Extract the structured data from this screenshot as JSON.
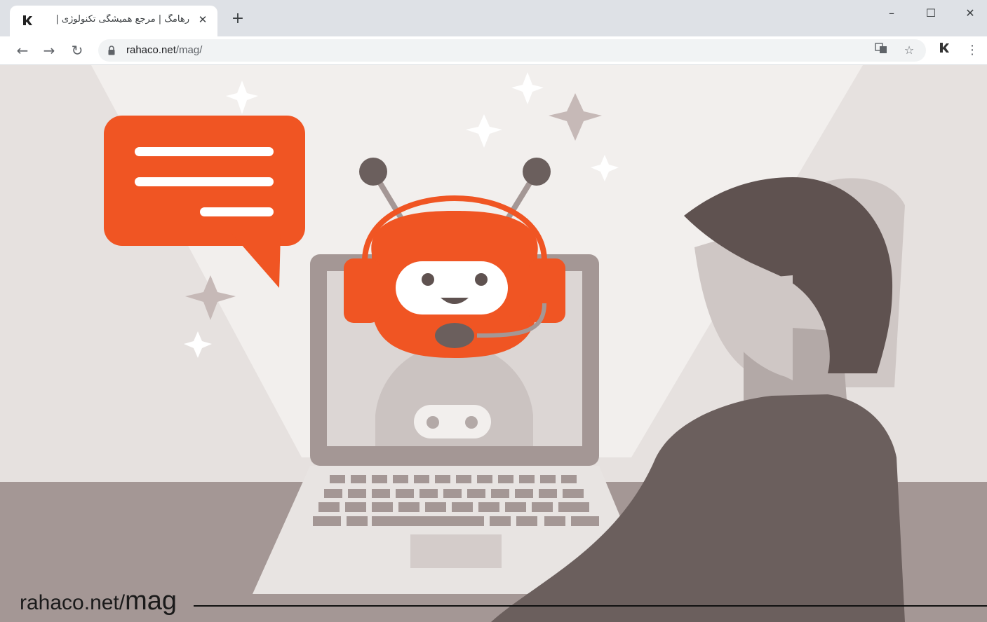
{
  "browser": {
    "tab": {
      "title": "رهامگ | مرجع همیشگی تکنولوژی |",
      "favicon": "rahaco-logo-icon",
      "close": "✕"
    },
    "new_tab_label": "+",
    "window_controls": {
      "minimize": "–",
      "maximize": "☐",
      "close": "✕"
    },
    "nav": {
      "back": "←",
      "forward": "→",
      "reload": "↻"
    },
    "address": {
      "host": "rahaco.net",
      "path": "/mag/"
    },
    "toolbar_icons": [
      "translate-icon",
      "star-icon",
      "extension-icon",
      "menu-icon"
    ]
  },
  "page": {
    "caption_prefix": "rahaco.net/",
    "caption_suffix": "mag",
    "colors": {
      "accent": "#f05523",
      "bg": "#e6e1df",
      "figure": "#5f5250"
    }
  }
}
